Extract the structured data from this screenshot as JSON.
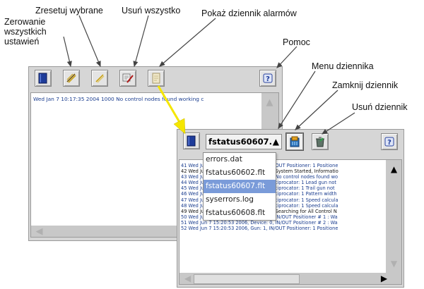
{
  "callouts": {
    "reset_selected": "Zresetuj wybrane",
    "delete_all": "Usuń wszystko",
    "show_alarm_log": "Pokaż dziennik alarmów",
    "reset_all_line1": "Zerowanie",
    "reset_all_line2": "wszystkich",
    "reset_all_line3": "ustawień",
    "help": "Pomoc",
    "log_menu": "Menu dziennika",
    "close_log": "Zamknij dziennik",
    "delete_log": "Usuń dziennik"
  },
  "main_window": {
    "log_line": "Wed Jan  7 10:17:35 2004  1000   No control nodes found working c"
  },
  "log_window": {
    "selected_log": "fstatus60607.",
    "dropdown_options": [
      "errors.dat",
      "fstatus60602.flt",
      "fstatus60607.flt",
      "syserrors.log",
      "fstatus60608.flt"
    ],
    "dropdown_selected_index": 2,
    "lines": [
      {
        "text": "41 Wed Jun  7 15:20:47 2006, Gun: 1, IN/OUT Positioner: 1 Positione",
        "color": "blue"
      },
      {
        "text": "42 Wed Jun  7 15:20:47 2006, Device: 0, System Started, Informatio",
        "color": "black"
      },
      {
        "text": "43 Wed Jun  7 15:20:47 2006, Device: 0, No control nodes found wo",
        "color": "blue"
      },
      {
        "text": "44 Wed Jun  7 15:20:47 2006, Gun: 1, Reciprocator: 1 Lead gun not",
        "color": "blue"
      },
      {
        "text": "45 Wed Jun  7 15:20:47 2006, Gun: 1, Reciprocator: 1 Trail gun not",
        "color": "blue"
      },
      {
        "text": "46 Wed Jun  7 15:20:47 2006, Gun: 1, Reciprocator: 1 Pattern width",
        "color": "blue"
      },
      {
        "text": "47 Wed Jun  7 15:20:47 2006, Gun: 1, Reciprocator: 1 Speed calcula",
        "color": "blue"
      },
      {
        "text": "48 Wed Jun  7 15:20:47 2006, Gun: 1, Reciprocator: 1 Speed calcula",
        "color": "blue"
      },
      {
        "text": "49 Wed Jun  7 15:20:49 2006, Device: 0, Searching for All Control N",
        "color": "black"
      },
      {
        "text": "50 Wed Jun  7 15:20:53 2006, Device: 0, IN/OUT Positioner # 1 : Wa",
        "color": "blue"
      },
      {
        "text": "51 Wed Jun  7 15:20:53 2006, Device: 0, IN/OUT Positioner # 2 : Wa",
        "color": "blue"
      },
      {
        "text": "52 Wed Jun  7 15:20:53 2006, Gun: 1, IN/OUT Positioner: 1 Positione",
        "color": "blue"
      }
    ]
  },
  "colors": {
    "highlight_arrow": "#f5e600",
    "selection": "#7a9bd9",
    "log_text_blue": "#1a3d8f"
  },
  "icons": {
    "main_toolbar": [
      "log-book-icon",
      "reset-all-icon",
      "reset-selected-icon",
      "delete-all-icon",
      "alarm-log-icon",
      "help-icon"
    ],
    "log_toolbar": [
      "log-book-icon",
      "close-log-icon",
      "delete-log-icon",
      "help-icon"
    ]
  }
}
